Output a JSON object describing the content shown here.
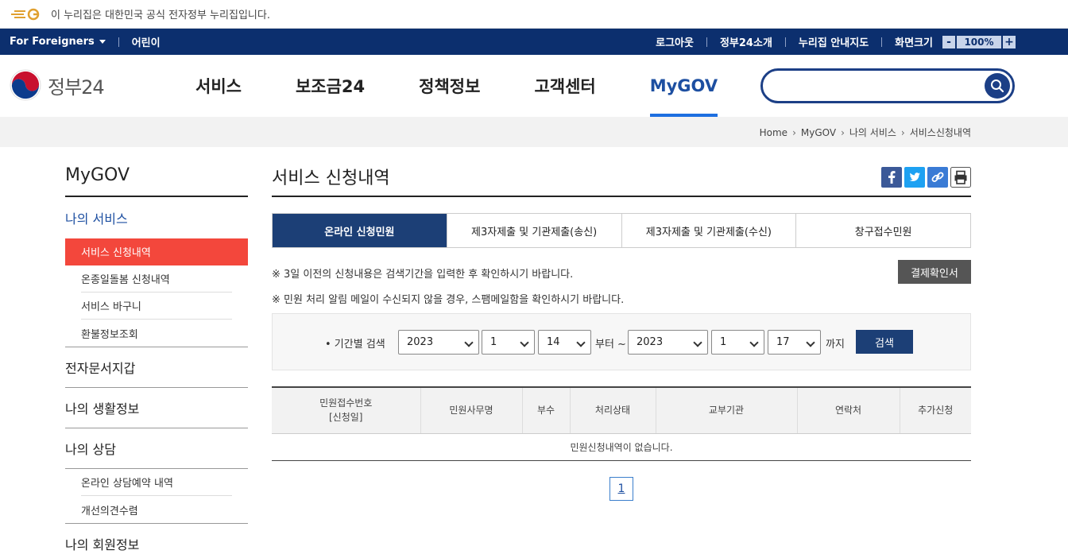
{
  "gov_banner": {
    "text": "이 누리집은 대한민국 공식 전자정부 누리집입니다."
  },
  "util": {
    "foreigners": "For Foreigners",
    "kids": "어린이",
    "logout": "로그아웃",
    "about": "정부24소개",
    "sitemap": "누리집 안내지도",
    "zoom_label": "화면크기",
    "zoom_minus": "-",
    "zoom_value": "100%",
    "zoom_plus": "+"
  },
  "header": {
    "logo_text": "정부24",
    "nav": [
      "서비스",
      "보조금24",
      "정책정보",
      "고객센터",
      "MyGOV"
    ],
    "active_nav": "MyGOV",
    "search_placeholder": ""
  },
  "breadcrumb": [
    "Home",
    "MyGOV",
    "나의 서비스",
    "서비스신청내역"
  ],
  "sidebar": {
    "title": "MyGOV",
    "section": "나의 서비스",
    "service_items": [
      "서비스 신청내역",
      "온종일돌봄 신청내역",
      "서비스 바구니",
      "환불정보조회"
    ],
    "groups": [
      "전자문서지갑",
      "나의 생활정보",
      "나의 상담"
    ],
    "counsel_items": [
      "온라인 상담예약 내역",
      "개선의견수렴"
    ],
    "last_group": "나의 회원정보"
  },
  "main": {
    "title": "서비스 신청내역",
    "tabs": [
      "온라인 신청민원",
      "제3자제출 및 기관제출(송신)",
      "제3자제출 및 기관제출(수신)",
      "창구접수민원"
    ],
    "notice1": "※ 3일 이전의 신청내용은 검색기간을 입력한 후 확인하시기 바랍니다.",
    "notice2": "※ 민원 처리 알림 메일이 수신되지 않을 경우, 스팸메일함을 확인하시기 바랍니다.",
    "receipt_button": "결제확인서",
    "search": {
      "label": "• 기간별 검색",
      "from_year": "2023",
      "from_month": "1",
      "from_day": "14",
      "from_text": "부터 ~",
      "to_year": "2023",
      "to_month": "1",
      "to_day": "17",
      "to_text": "까지",
      "button": "검색"
    },
    "table": {
      "headers": [
        "민원접수번호",
        "[신청일]",
        "민원사무명",
        "부수",
        "처리상태",
        "교부기관",
        "연락처",
        "추가신청"
      ],
      "empty": "민원신청내역이 없습니다."
    },
    "page": "1"
  }
}
